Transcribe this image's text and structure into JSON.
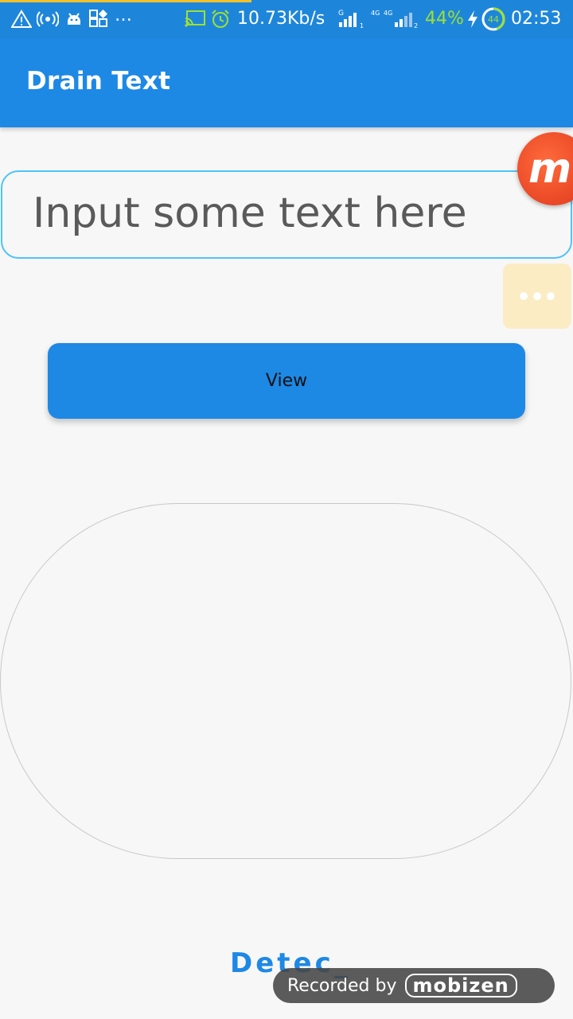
{
  "status_bar": {
    "network_speed": "10.73Kb/s",
    "sim1_label": "G",
    "sim2_label": "4G 4G",
    "battery_percent": "44%",
    "battery_ring": "44",
    "time": "02:53",
    "colors": {
      "background": "#1e86da",
      "accent": "#9de034"
    },
    "icons": [
      "warning-icon",
      "hotspot-icon",
      "android-icon",
      "apps-icon",
      "more-icon",
      "cast-icon",
      "alarm-icon",
      "signal-icon",
      "signal-icon",
      "charging-icon",
      "battery-icon"
    ]
  },
  "app_bar": {
    "title": "Drain Text",
    "color": "#1e88e5"
  },
  "input": {
    "placeholder": "Input some text here",
    "value": ""
  },
  "overlay": {
    "bubble_letter": "m",
    "more_icon": "more-dots-icon"
  },
  "view_button": {
    "label": "View"
  },
  "bottom": {
    "detected_text": "Detec_"
  },
  "recording": {
    "label": "Recorded by",
    "brand": "mobizen"
  }
}
